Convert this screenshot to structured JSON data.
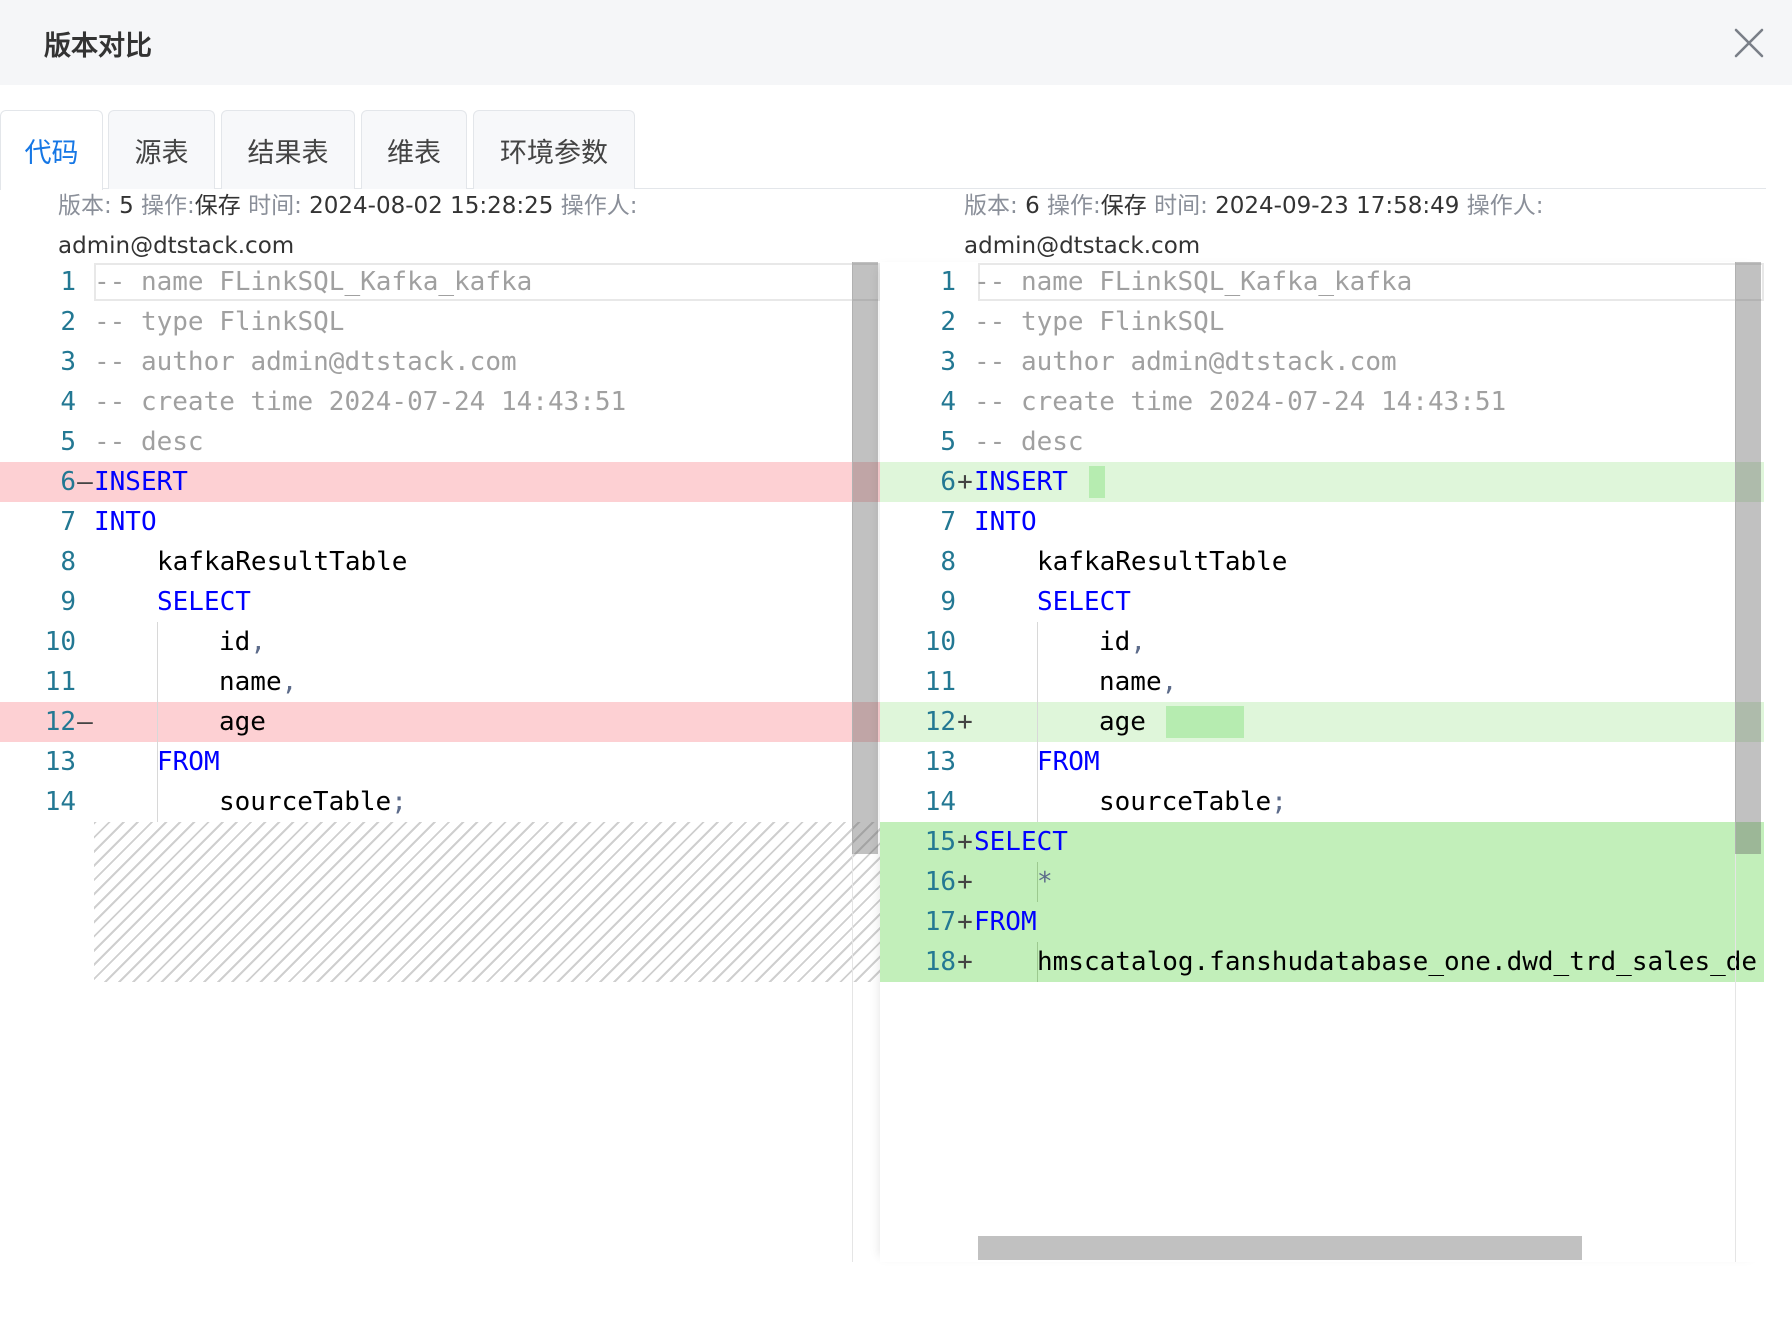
{
  "dialog": {
    "title": "版本对比"
  },
  "tabs": [
    {
      "label": "代码",
      "active": true
    },
    {
      "label": "源表",
      "active": false
    },
    {
      "label": "结果表",
      "active": false
    },
    {
      "label": "维表",
      "active": false
    },
    {
      "label": "环境参数",
      "active": false
    }
  ],
  "left": {
    "meta": {
      "version_label": "版本:",
      "version": "5",
      "op_label": "操作:",
      "op": "保存",
      "time_label": "时间:",
      "time": "2024-08-02 15:28:25",
      "operator_label": "操作人:",
      "operator": "admin@dtstack.com"
    },
    "lines": [
      {
        "n": "1",
        "m": "",
        "t": "-- name FLinkSQL_Kafka_kafka"
      },
      {
        "n": "2",
        "m": "",
        "t": "-- type FlinkSQL"
      },
      {
        "n": "3",
        "m": "",
        "t": "-- author admin@dtstack.com"
      },
      {
        "n": "4",
        "m": "",
        "t": "-- create time 2024-07-24 14:43:51"
      },
      {
        "n": "5",
        "m": "",
        "t": "-- desc"
      },
      {
        "n": "6",
        "m": "—",
        "t": "INSERT"
      },
      {
        "n": "7",
        "m": "",
        "t": "INTO"
      },
      {
        "n": "8",
        "m": "",
        "t": "kafkaResultTable"
      },
      {
        "n": "9",
        "m": "",
        "t": "SELECT"
      },
      {
        "n": "10",
        "m": "",
        "t": "id"
      },
      {
        "n": "11",
        "m": "",
        "t": "name"
      },
      {
        "n": "12",
        "m": "—",
        "t": "age"
      },
      {
        "n": "13",
        "m": "",
        "t": "FROM"
      },
      {
        "n": "14",
        "m": "",
        "t": "sourceTable"
      }
    ]
  },
  "right": {
    "meta": {
      "version_label": "版本:",
      "version": "6",
      "op_label": "操作:",
      "op": "保存",
      "time_label": "时间:",
      "time": "2024-09-23 17:58:49",
      "operator_label": "操作人:",
      "operator": "admin@dtstack.com"
    },
    "lines": [
      {
        "n": "1",
        "m": "",
        "t": "-- name FLinkSQL_Kafka_kafka"
      },
      {
        "n": "2",
        "m": "",
        "t": "-- type FlinkSQL"
      },
      {
        "n": "3",
        "m": "",
        "t": "-- author admin@dtstack.com"
      },
      {
        "n": "4",
        "m": "",
        "t": "-- create time 2024-07-24 14:43:51"
      },
      {
        "n": "5",
        "m": "",
        "t": "-- desc"
      },
      {
        "n": "6",
        "m": "+",
        "t": "INSERT"
      },
      {
        "n": "7",
        "m": "",
        "t": "INTO"
      },
      {
        "n": "8",
        "m": "",
        "t": "kafkaResultTable"
      },
      {
        "n": "9",
        "m": "",
        "t": "SELECT"
      },
      {
        "n": "10",
        "m": "",
        "t": "id"
      },
      {
        "n": "11",
        "m": "",
        "t": "name"
      },
      {
        "n": "12",
        "m": "+",
        "t": "age"
      },
      {
        "n": "13",
        "m": "",
        "t": "FROM"
      },
      {
        "n": "14",
        "m": "",
        "t": "sourceTable"
      },
      {
        "n": "15",
        "m": "+",
        "t": "SELECT"
      },
      {
        "n": "16",
        "m": "+",
        "t": "*"
      },
      {
        "n": "17",
        "m": "+",
        "t": "FROM"
      },
      {
        "n": "18",
        "m": "+",
        "t": "hmscatalog.fanshudatabase_one.dwd_trd_sales_de"
      }
    ]
  },
  "punct": {
    "comma": ",",
    "semicolon": ";",
    "dot": "."
  },
  "colors": {
    "accent": "#1677e5",
    "deleted": "#fdd0d3",
    "added_light": "#dff6da",
    "added": "#c2efba",
    "keyword": "#0000ff",
    "comment": "#a0a0a0",
    "line_number": "#237893"
  },
  "icons": {
    "close": "close-icon"
  }
}
